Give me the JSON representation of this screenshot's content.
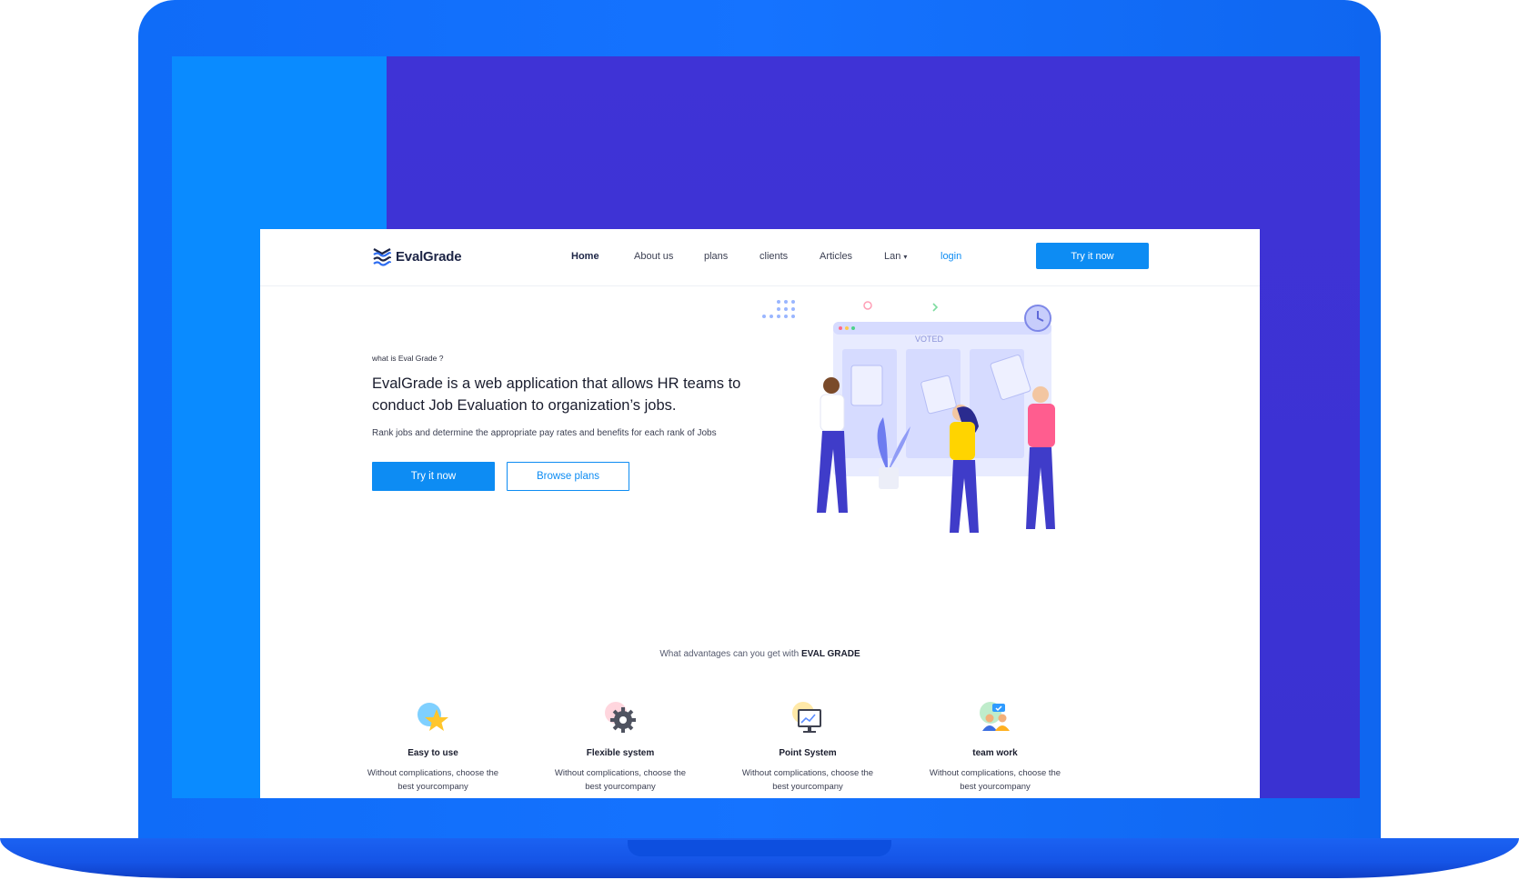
{
  "nav": {
    "brand": "EvalGrade",
    "links": [
      {
        "label": "Home"
      },
      {
        "label": "About us"
      },
      {
        "label": "plans"
      },
      {
        "label": "clients"
      },
      {
        "label": "Articles"
      },
      {
        "label": "Lan"
      }
    ],
    "login": "login",
    "cta": "Try it now"
  },
  "hero": {
    "eyebrow": "what is Eval Grade ?",
    "title": "EvalGrade is a web application that allows HR teams to conduct Job Evaluation to organization’s jobs.",
    "subtitle": "Rank jobs and determine the appropriate pay rates and benefits for each rank of Jobs",
    "primary_button": "Try it now",
    "secondary_button": "Browse plans",
    "illustration_label": "VOTED"
  },
  "advantages": {
    "heading_prefix": "What advantages can you get with",
    "heading_brand": "EVAL GRADE",
    "items": [
      {
        "title": "Easy to use",
        "desc": "Without complications, choose the best yourcompany",
        "icon": "star-icon"
      },
      {
        "title": "Flexible system",
        "desc": "Without complications, choose the best yourcompany",
        "icon": "gear-icon"
      },
      {
        "title": "Point System",
        "desc": "Without complications, choose the best yourcompany",
        "icon": "monitor-chart-icon"
      },
      {
        "title": "team work",
        "desc": "Without complications, choose the best yourcompany",
        "icon": "team-icon"
      }
    ]
  },
  "colors": {
    "primary": "#0d8cf3",
    "laptop_frame": "#1573ff",
    "screen_left": "#0a8bff",
    "screen_right": "#3c33d4"
  }
}
